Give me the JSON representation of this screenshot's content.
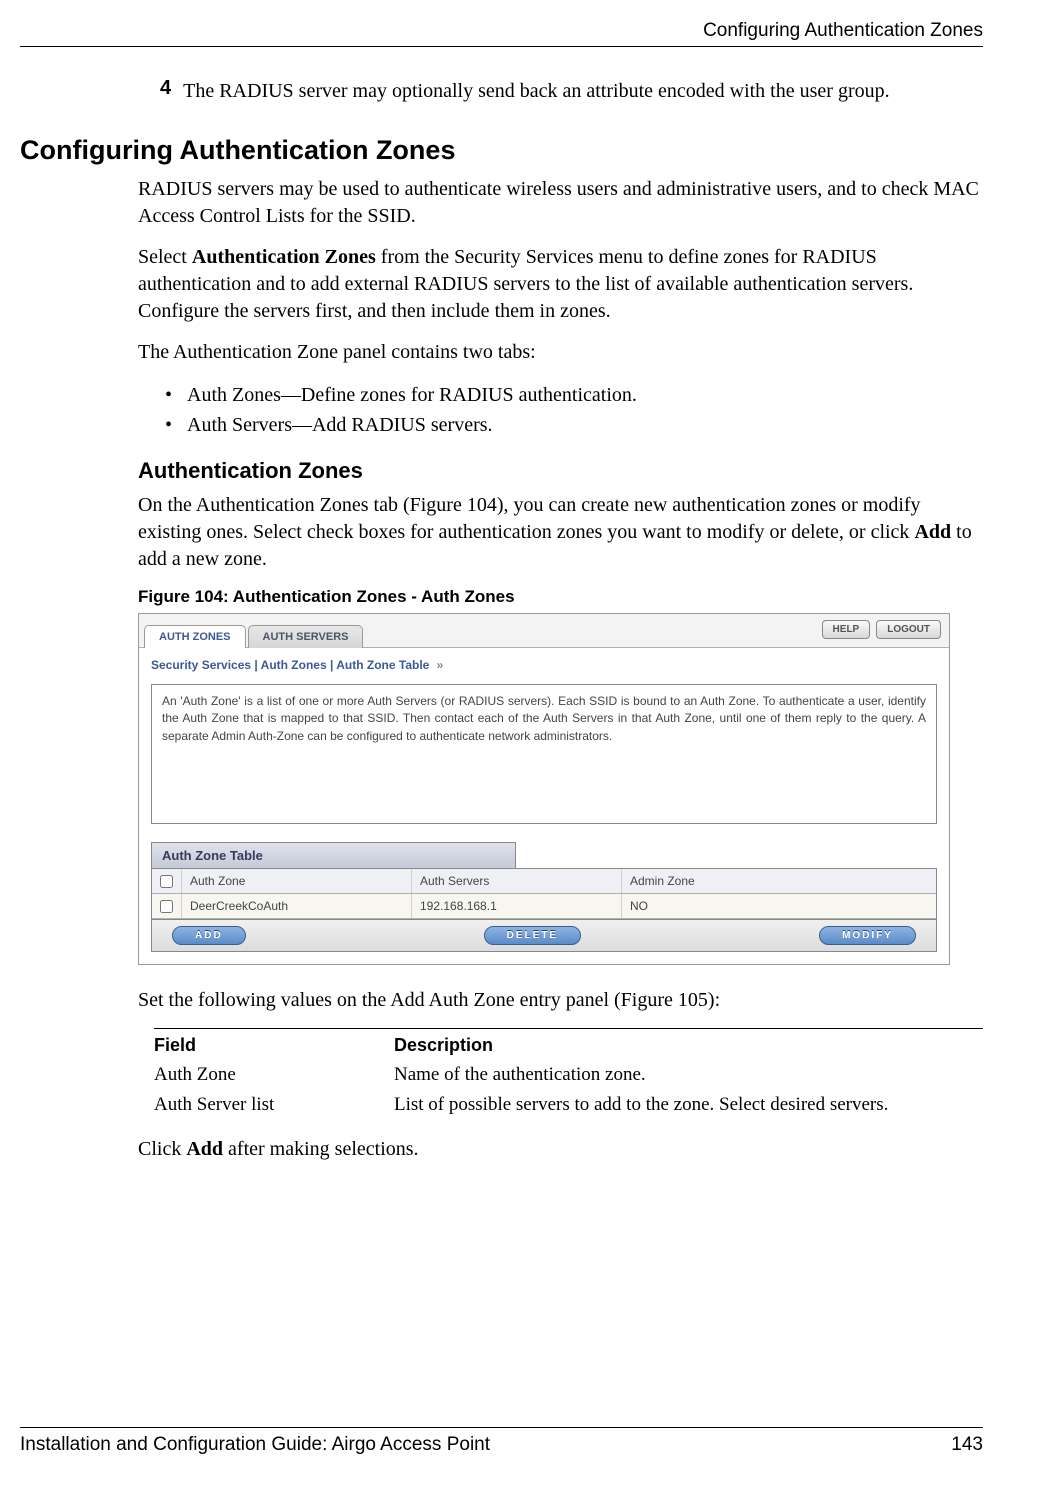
{
  "header": {
    "running_title": "Configuring Authentication Zones"
  },
  "step": {
    "number": "4",
    "text": "The RADIUS server may optionally send back an attribute encoded with the user group."
  },
  "main_heading": "Configuring Authentication Zones",
  "para1": "RADIUS servers may be used to authenticate wireless users and administrative users, and to check MAC Access Control Lists for the SSID.",
  "para2_pre": "Select ",
  "para2_bold": "Authentication Zones",
  "para2_post": " from the Security Services menu to define zones for RADIUS authentication and to add external RADIUS servers to the list of available authentication servers. Configure the servers first, and then include them in zones.",
  "para3": "The Authentication Zone panel contains two tabs:",
  "bullets": [
    "Auth Zones—Define zones for RADIUS authentication.",
    "Auth Servers—Add RADIUS servers."
  ],
  "sub_heading": "Authentication Zones",
  "para4_pre": "On the Authentication Zones tab (Figure 104), you can create new authentication zones or modify existing ones. Select check boxes for authentication zones you want to modify or delete, or click ",
  "para4_bold": "Add",
  "para4_post": " to add a new zone.",
  "figure_caption": "Figure 104:    Authentication Zones - Auth Zones",
  "screenshot": {
    "tabs": {
      "active": "AUTH ZONES",
      "other": "AUTH SERVERS"
    },
    "header_buttons": {
      "help": "HELP",
      "logout": "LOGOUT"
    },
    "breadcrumb": "Security Services | Auth Zones | Auth Zone Table",
    "breadcrumb_arrow": "»",
    "info": "An 'Auth Zone' is a list of one or more Auth Servers (or RADIUS servers). Each SSID is bound to an Auth Zone. To authenticate a user, identify the Auth Zone that is mapped to that SSID. Then contact each of the Auth Servers in that Auth Zone, until one of them reply to the query. A separate Admin Auth-Zone can be configured to authenticate network administrators.",
    "table_title": "Auth Zone Table",
    "columns": [
      "Auth Zone",
      "Auth Servers",
      "Admin Zone"
    ],
    "rows": [
      {
        "zone": "DeerCreekCoAuth",
        "servers": "192.168.168.1",
        "admin": "NO"
      }
    ],
    "buttons": {
      "add": "ADD",
      "delete": "DELETE",
      "modify": "MODIFY"
    }
  },
  "para5": "Set the following values on the Add Auth Zone entry panel (Figure 105):",
  "field_table": {
    "headers": {
      "field": "Field",
      "description": "Description"
    },
    "rows": [
      {
        "field": "Auth Zone",
        "desc": "Name of the authentication zone."
      },
      {
        "field": "Auth Server list",
        "desc": "List of possible servers to add to the zone. Select desired servers."
      }
    ]
  },
  "para6_pre": "Click ",
  "para6_bold": "Add",
  "para6_post": " after making selections.",
  "footer": {
    "left": "Installation and Configuration Guide: Airgo Access Point",
    "right": "143"
  }
}
